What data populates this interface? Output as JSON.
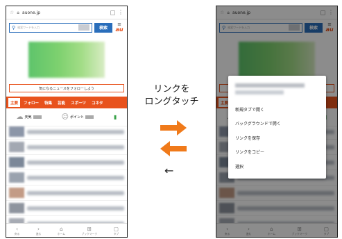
{
  "browser": {
    "url": "auone.jp"
  },
  "search": {
    "placeholder": "検索ワードを入力",
    "button": "検索",
    "brand": "au"
  },
  "follow_banner": "気になるニュースをフォローしよう",
  "tabs": [
    "主要",
    "フォロー",
    "特集",
    "芸能",
    "スポーツ",
    "コネタ"
  ],
  "weather": {
    "weather_label": "天気",
    "points_label": "ポイント"
  },
  "bottom_nav": [
    {
      "icon": "back-icon",
      "label": "戻る"
    },
    {
      "icon": "forward-icon",
      "label": "進む"
    },
    {
      "icon": "home-icon",
      "label": "ホーム"
    },
    {
      "icon": "bookmark-icon",
      "label": "ブックマーク"
    },
    {
      "icon": "tabs-icon",
      "label": "タブ"
    }
  ],
  "context_menu": {
    "items": [
      "新規タブで開く",
      "バックグラウンドで開く",
      "リンクを保存",
      "リンクをコピー",
      "選択"
    ]
  },
  "instruction": {
    "line1": "リンクを",
    "line2": "ロングタッチ",
    "back_symbol": "←"
  },
  "colors": {
    "accent": "#e8521c",
    "search_blue": "#2a6ebb"
  }
}
